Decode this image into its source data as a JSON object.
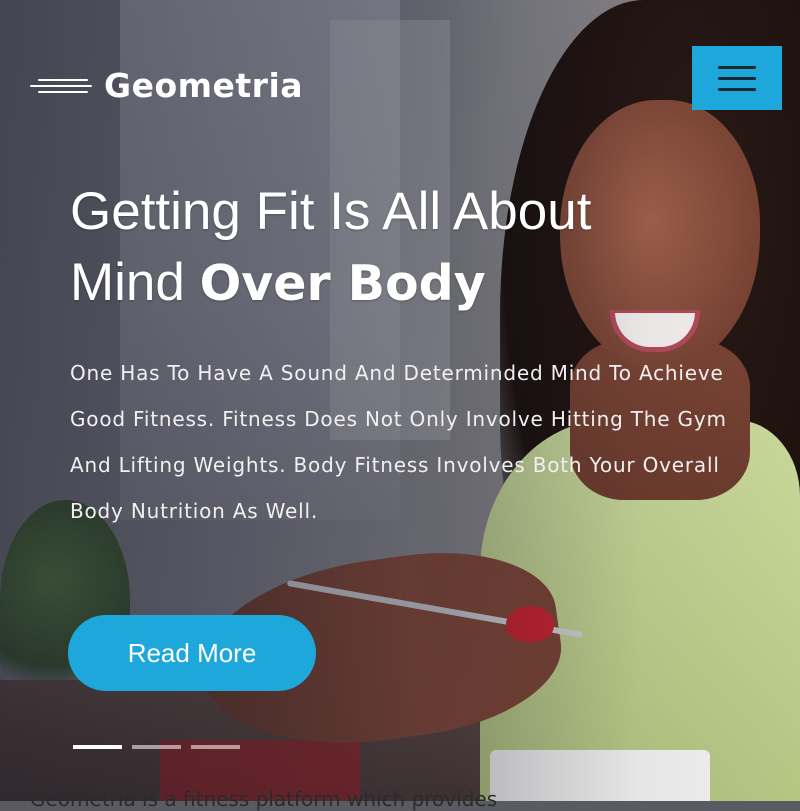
{
  "brand": {
    "name": "Geometria"
  },
  "nav": {
    "menu_icon": "hamburger-menu-icon",
    "menu_button_color": "#1ea7db"
  },
  "hero": {
    "headline_line1": "Getting Fit Is All About",
    "headline_line2_regular": "Mind ",
    "headline_line2_bold": "Over Body",
    "description": "One Has To Have A Sound And Determinded Mind To Achieve Good Fitness. Fitness Does Not Only Involve Hitting The Gym And Lifting Weights. Body Fitness Involves Both Your Overall Body Nutrition As Well.",
    "cta_label": "Read More",
    "cta_color": "#1ea7db"
  },
  "slider": {
    "total_slides": 3,
    "active_slide": 1
  },
  "below_fold_peek": "Geometria is a fitness platform which provides"
}
